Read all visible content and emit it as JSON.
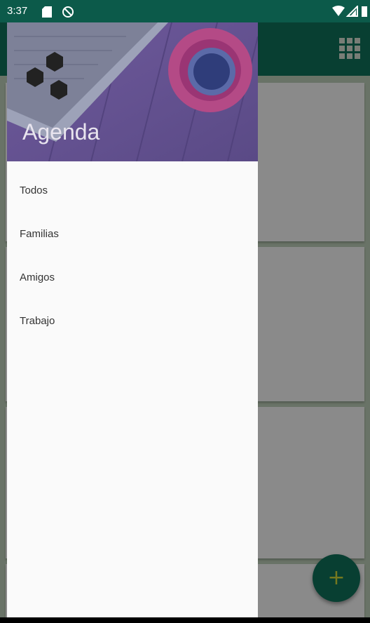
{
  "status_bar": {
    "time": "3:37",
    "icons": [
      "sd-card-icon",
      "sync-off-icon",
      "wifi-icon",
      "signal-icon",
      "battery-icon"
    ]
  },
  "app_bar": {
    "background_color": "#0f6d57",
    "icon": "grid-view-icon"
  },
  "drawer": {
    "title": "Agenda",
    "logo_icon": "hexagons-logo-icon",
    "items": [
      {
        "label": "Todos"
      },
      {
        "label": "Familias"
      },
      {
        "label": "Amigos"
      },
      {
        "label": "Trabajo"
      }
    ]
  },
  "fab": {
    "icon": "plus-icon",
    "symbol": "+",
    "background_color": "#0f6d57",
    "icon_color": "#c9cf36"
  },
  "colors": {
    "primary": "#0f6d57",
    "primary_dark": "#0c5a4a",
    "drawer_background": "#fafafa",
    "accent": "#c9cf36"
  }
}
